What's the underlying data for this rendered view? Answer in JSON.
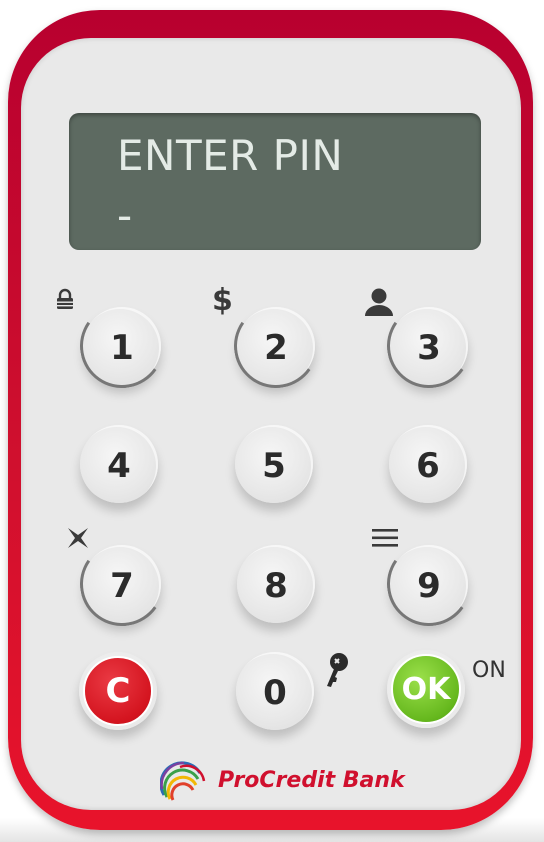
{
  "display": {
    "line1": "ENTER PIN",
    "line2": "-"
  },
  "keypad": {
    "keys": [
      {
        "label": "1",
        "icon": "lock-icon"
      },
      {
        "label": "2",
        "icon": "dollar-icon"
      },
      {
        "label": "3",
        "icon": "user-icon"
      },
      {
        "label": "4"
      },
      {
        "label": "5"
      },
      {
        "label": "6"
      },
      {
        "label": "7",
        "icon": "sparkle-icon"
      },
      {
        "label": "8"
      },
      {
        "label": "9",
        "icon": "menu-icon"
      },
      {
        "label": "C"
      },
      {
        "label": "0",
        "icon": "key-icon"
      },
      {
        "label": "OK"
      }
    ],
    "dollar_symbol": "$",
    "on_label": "ON"
  },
  "brand": {
    "name": "ProCredit Bank"
  },
  "colors": {
    "device_red": "#d0102e",
    "lcd_background": "#5d6a61",
    "lcd_text": "#e4ebe6",
    "clear_button": "#d4141f",
    "ok_button": "#66b81e",
    "panel": "#e9e9e9"
  }
}
